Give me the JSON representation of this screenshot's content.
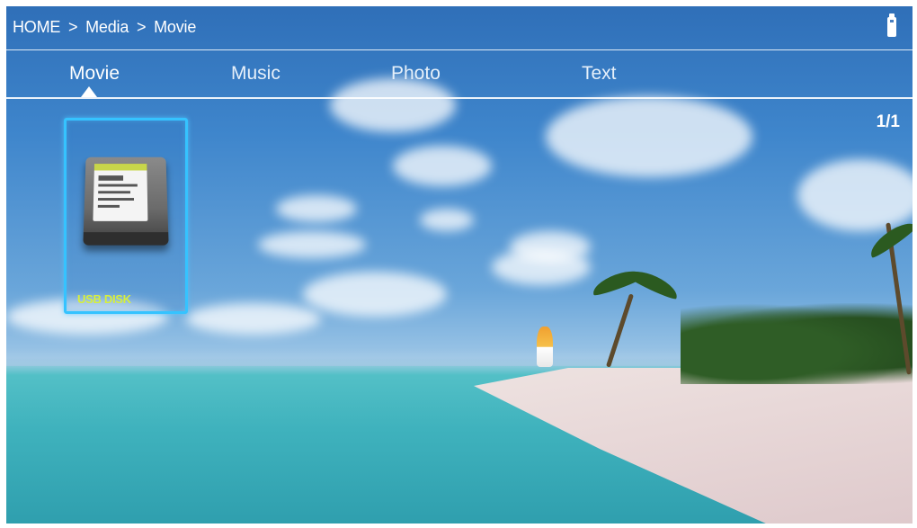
{
  "header": {
    "breadcrumb": [
      "HOME",
      ">",
      "Media",
      ">",
      "Movie"
    ],
    "status_icon": "usb-drive-icon"
  },
  "tabs": [
    {
      "label": "Movie",
      "active": true
    },
    {
      "label": "Music",
      "active": false
    },
    {
      "label": "Photo",
      "active": false
    },
    {
      "label": "Text",
      "active": false
    }
  ],
  "page_indicator": "1/1",
  "devices": [
    {
      "name": "USB DISK",
      "icon": "hard-disk-icon",
      "selected": true
    }
  ],
  "colors": {
    "selection_border": "#35c3ff",
    "device_label": "#d7ef3c"
  }
}
